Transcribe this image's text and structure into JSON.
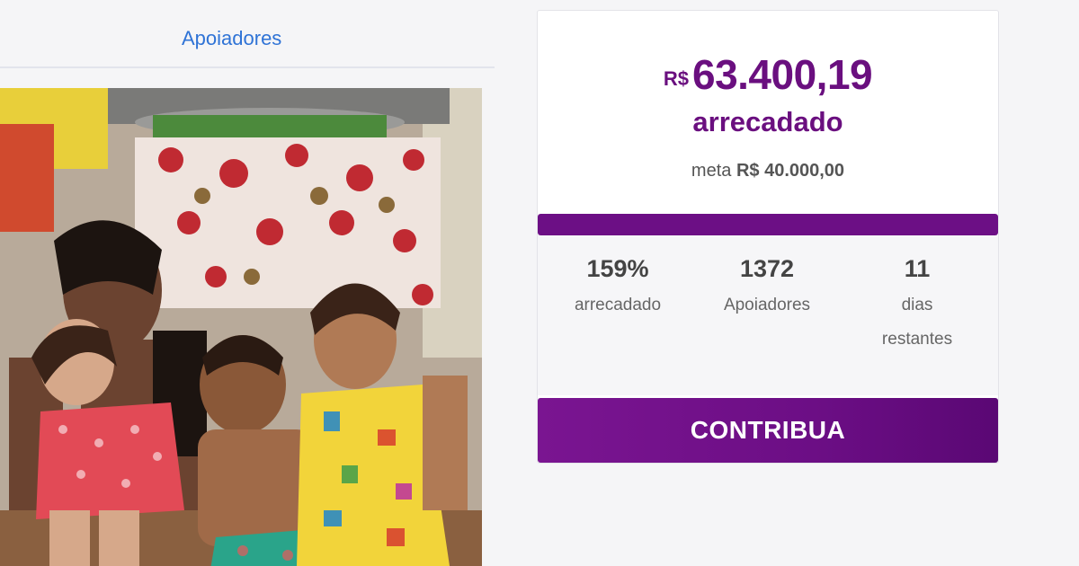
{
  "tabs": {
    "supporters_label": "Apoiadores"
  },
  "photo": {
    "alt": "Family photo"
  },
  "campaign": {
    "currency": "R$",
    "amount": "63.400,19",
    "raised_label": "arrecadado",
    "goal_prefix": "meta",
    "goal_value": "R$ 40.000,00",
    "progress_fraction": 1.0,
    "accent_color": "#6a0f7f",
    "stats": [
      {
        "value": "159%",
        "label": "arrecadado"
      },
      {
        "value": "1372",
        "label": "Apoiadores"
      },
      {
        "value": "11",
        "label_line1": "dias",
        "label_line2": "restantes"
      }
    ],
    "cta_label": "CONTRIBUA"
  }
}
